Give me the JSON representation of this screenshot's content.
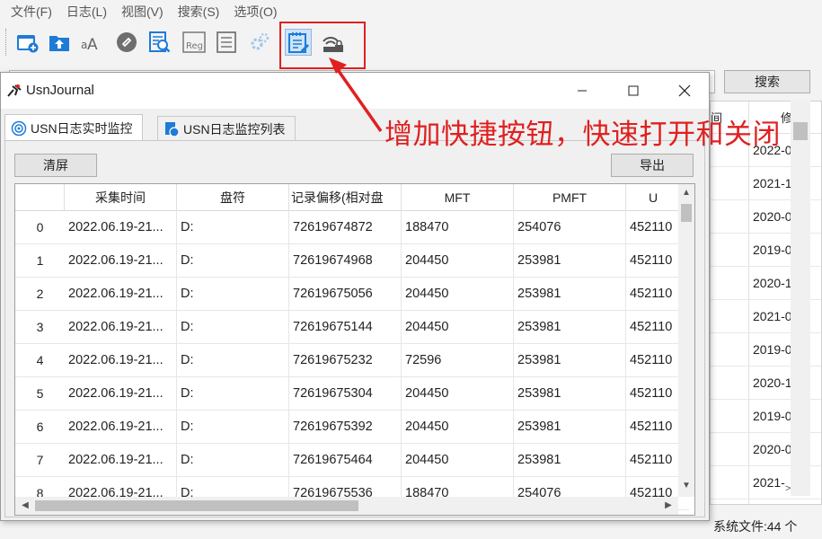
{
  "menubar": {
    "items": [
      {
        "label": "文件(F)"
      },
      {
        "label": "日志(L)"
      },
      {
        "label": "视图(V)"
      },
      {
        "label": "搜索(S)"
      },
      {
        "label": "选项(O)"
      }
    ]
  },
  "toolbar": {
    "buttons": [
      {
        "icon": "new-folder-icon"
      },
      {
        "icon": "upload-icon"
      },
      {
        "icon": "font-case-icon"
      },
      {
        "icon": "link-icon"
      },
      {
        "icon": "search-list-icon"
      },
      {
        "icon": "regex-icon"
      },
      {
        "icon": "list-icon"
      },
      {
        "icon": "settings-icon"
      },
      {
        "icon": "notepad-icon"
      },
      {
        "icon": "network-lock-icon"
      }
    ]
  },
  "main": {
    "search_button": "搜索",
    "header_partial": [
      "间",
      "修"
    ],
    "rows": [
      "2022-0",
      "2021-1",
      "2020-0",
      "2019-0",
      "2020-1",
      "2021-0",
      "2019-0",
      "2020-1",
      "2019-0",
      "2020-0",
      "2021-"
    ],
    "status": "系统文件:44 个"
  },
  "annotation": {
    "text": "增加快捷按钮，快速打开和关闭",
    "color": "#e02020"
  },
  "dialog": {
    "title": "UsnJournal",
    "tabs": [
      {
        "label": "USN日志实时监控",
        "icon": "radar-icon"
      },
      {
        "label": "USN日志监控列表",
        "icon": "file-monitor-icon"
      }
    ],
    "clear_button": "清屏",
    "export_button": "导出",
    "table": {
      "columns": [
        "采集时间",
        "盘符",
        "记录偏移(相对盘",
        "MFT",
        "PMFT",
        "U"
      ],
      "rows": [
        {
          "idx": "0",
          "time": "2022.06.19-21...",
          "drive": "D:",
          "offset": "72619674872",
          "mft": "188470",
          "pmft": "254076",
          "u": "452110"
        },
        {
          "idx": "1",
          "time": "2022.06.19-21...",
          "drive": "D:",
          "offset": "72619674968",
          "mft": "204450",
          "pmft": "253981",
          "u": "452110"
        },
        {
          "idx": "2",
          "time": "2022.06.19-21...",
          "drive": "D:",
          "offset": "72619675056",
          "mft": "204450",
          "pmft": "253981",
          "u": "452110"
        },
        {
          "idx": "3",
          "time": "2022.06.19-21...",
          "drive": "D:",
          "offset": "72619675144",
          "mft": "204450",
          "pmft": "253981",
          "u": "452110"
        },
        {
          "idx": "4",
          "time": "2022.06.19-21...",
          "drive": "D:",
          "offset": "72619675232",
          "mft": "72596",
          "pmft": "253981",
          "u": "452110"
        },
        {
          "idx": "5",
          "time": "2022.06.19-21...",
          "drive": "D:",
          "offset": "72619675304",
          "mft": "204450",
          "pmft": "253981",
          "u": "452110"
        },
        {
          "idx": "6",
          "time": "2022.06.19-21...",
          "drive": "D:",
          "offset": "72619675392",
          "mft": "204450",
          "pmft": "253981",
          "u": "452110"
        },
        {
          "idx": "7",
          "time": "2022.06.19-21...",
          "drive": "D:",
          "offset": "72619675464",
          "mft": "204450",
          "pmft": "253981",
          "u": "452110"
        },
        {
          "idx": "8",
          "time": "2022.06.19-21...",
          "drive": "D:",
          "offset": "72619675536",
          "mft": "188470",
          "pmft": "254076",
          "u": "452110"
        }
      ]
    }
  }
}
